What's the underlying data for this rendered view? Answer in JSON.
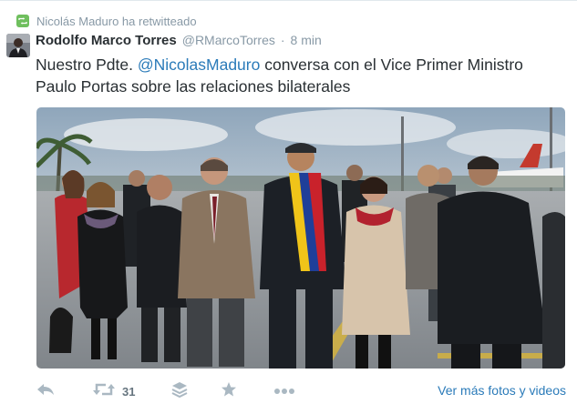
{
  "retweet_banner": {
    "text": "Nicolás Maduro ha retwitteado"
  },
  "tweet": {
    "author_name": "Rodolfo Marco Torres",
    "author_handle": "@RMarcoTorres",
    "separator": "·",
    "time": "8 min",
    "text_before": "Nuestro Pdte. ",
    "mention": "@NicolasMaduro",
    "text_after": " conversa con el  Vice Primer Ministro Paulo Portas sobre las relaciones bilaterales"
  },
  "actions": {
    "reply_icon": "reply-icon",
    "retweet_icon": "retweet-icon",
    "retweet_count": "31",
    "favorite_icon": "star-icon",
    "more_icon": "ellipsis-icon",
    "stack_icon": "stack-icon",
    "more_link": "Ver más fotos y videos"
  },
  "colors": {
    "link": "#2b7bb9",
    "meta": "#8899a6",
    "retweet_green": "#6fbf5e",
    "action_gray": "#aab8c2"
  }
}
